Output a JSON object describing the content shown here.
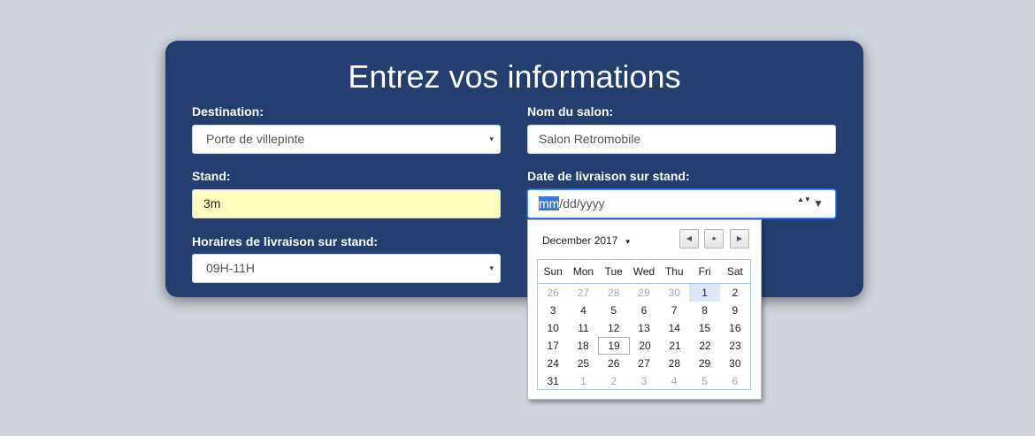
{
  "form": {
    "title": "Entrez vos informations",
    "destination": {
      "label": "Destination:",
      "value": "Porte de villepinte"
    },
    "salon": {
      "label": "Nom du salon:",
      "value": "Salon Retromobile"
    },
    "stand": {
      "label": "Stand:",
      "value": "3m"
    },
    "date": {
      "label": "Date de livraison sur stand:",
      "mm": "mm",
      "rest": "/dd/yyyy"
    },
    "horaires": {
      "label": "Horaires de livraison sur stand:",
      "value": "09H-11H"
    }
  },
  "calendar": {
    "month_label": "December 2017",
    "weekdays": [
      "Sun",
      "Mon",
      "Tue",
      "Wed",
      "Thu",
      "Fri",
      "Sat"
    ],
    "weeks": [
      [
        {
          "d": "26",
          "o": true
        },
        {
          "d": "27",
          "o": true
        },
        {
          "d": "28",
          "o": true
        },
        {
          "d": "29",
          "o": true
        },
        {
          "d": "30",
          "o": true
        },
        {
          "d": "1",
          "sel": true
        },
        {
          "d": "2"
        }
      ],
      [
        {
          "d": "3"
        },
        {
          "d": "4"
        },
        {
          "d": "5"
        },
        {
          "d": "6"
        },
        {
          "d": "7"
        },
        {
          "d": "8"
        },
        {
          "d": "9"
        }
      ],
      [
        {
          "d": "10"
        },
        {
          "d": "11"
        },
        {
          "d": "12"
        },
        {
          "d": "13"
        },
        {
          "d": "14"
        },
        {
          "d": "15"
        },
        {
          "d": "16"
        }
      ],
      [
        {
          "d": "17"
        },
        {
          "d": "18"
        },
        {
          "d": "19",
          "today": true
        },
        {
          "d": "20"
        },
        {
          "d": "21"
        },
        {
          "d": "22"
        },
        {
          "d": "23"
        }
      ],
      [
        {
          "d": "24"
        },
        {
          "d": "25"
        },
        {
          "d": "26"
        },
        {
          "d": "27"
        },
        {
          "d": "28"
        },
        {
          "d": "29"
        },
        {
          "d": "30"
        }
      ],
      [
        {
          "d": "31"
        },
        {
          "d": "1",
          "o": true
        },
        {
          "d": "2",
          "o": true
        },
        {
          "d": "3",
          "o": true
        },
        {
          "d": "4",
          "o": true
        },
        {
          "d": "5",
          "o": true
        },
        {
          "d": "6",
          "o": true
        }
      ]
    ]
  },
  "icons": {
    "select_arrow": "▾",
    "spin": "▲▼",
    "dropdown": "▼",
    "month_caret": "▼",
    "prev": "◀",
    "today": "●",
    "next": "▶"
  },
  "colors": {
    "card": "#233e6f",
    "background": "#ced3dc",
    "highlight_input": "#fbfcbd",
    "selected_day": "#dce6f5"
  }
}
